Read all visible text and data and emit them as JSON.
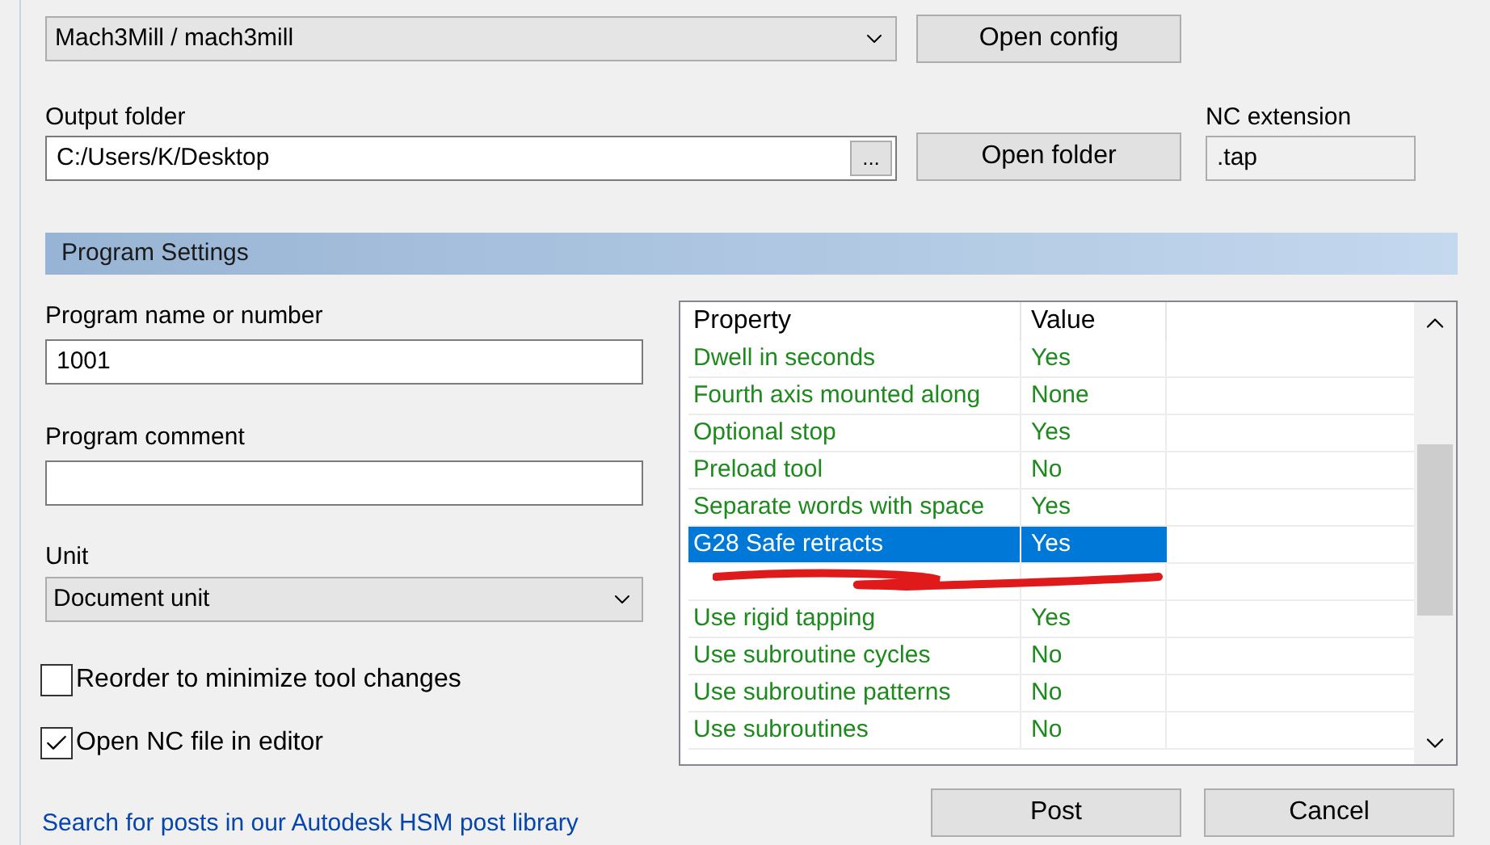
{
  "post_config": {
    "value": "Mach3Mill / mach3mill",
    "button": "Open config"
  },
  "output": {
    "label": "Output folder",
    "value": "C:/Users/K/Desktop",
    "browse": "...",
    "button": "Open folder"
  },
  "extension": {
    "label": "NC extension",
    "value": ".tap"
  },
  "section": {
    "title": "Program Settings"
  },
  "program_name": {
    "label": "Program name or number",
    "value": "1001"
  },
  "program_comment": {
    "label": "Program comment"
  },
  "unit": {
    "label": "Unit",
    "value": "Document unit"
  },
  "options": [
    {
      "label": "Reorder to minimize tool changes",
      "checked": false
    },
    {
      "label": "Open NC file in editor",
      "checked": true
    }
  ],
  "table": {
    "columns": [
      "Property",
      "Value"
    ],
    "rows": [
      {
        "property": "Dwell in seconds",
        "value": "Yes",
        "selected": false
      },
      {
        "property": "Fourth axis mounted along",
        "value": "None",
        "selected": false
      },
      {
        "property": "Optional stop",
        "value": "Yes",
        "selected": false
      },
      {
        "property": "Preload tool",
        "value": "No",
        "selected": false
      },
      {
        "property": "Separate words with space",
        "value": "Yes",
        "selected": false
      },
      {
        "property": "G28 Safe retracts",
        "value": "Yes",
        "selected": true
      },
      {
        "kind": "covered",
        "selected": false
      },
      {
        "property": "Use rigid tapping",
        "value": "Yes",
        "selected": false
      },
      {
        "property": "Use subroutine cycles",
        "value": "No",
        "selected": false
      },
      {
        "property": "Use subroutine patterns",
        "value": "No",
        "selected": false
      },
      {
        "property": "Use subroutines",
        "value": "No",
        "selected": false
      }
    ]
  },
  "link": "Search for posts in our Autodesk HSM post library",
  "buttons": [
    "Post",
    "Cancel"
  ]
}
